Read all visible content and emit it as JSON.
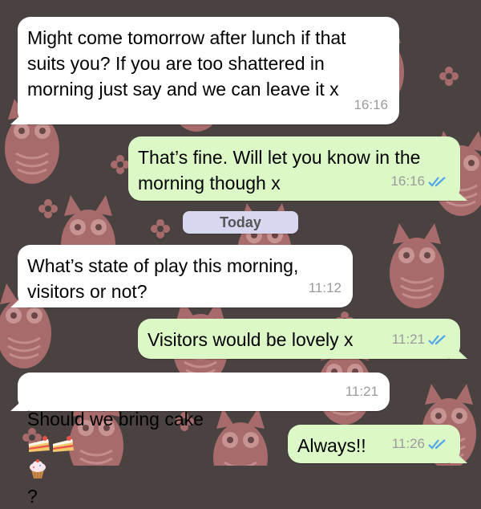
{
  "chat": {
    "date_separator": "Today",
    "messages": [
      {
        "text": "Might come tomorrow after lunch if that\nsuits you? If you are too shattered in\nmorning just say and we can leave it x",
        "time": "16:16"
      },
      {
        "text": "That’s fine. Will let you know in the\nmorning though x",
        "time": "16:16",
        "status_icon": "double-check-icon"
      },
      {
        "text": "What’s state of play this morning,\nvisitors or not?",
        "time": "11:12"
      },
      {
        "text": "Visitors would be lovely x",
        "time": "11:21",
        "status_icon": "double-check-icon"
      },
      {
        "text_before": "Should we bring cake",
        "emojis": [
          "cake-slice-icon",
          "cake-slice-icon",
          "cupcake-icon"
        ],
        "text_after": "?",
        "time": "11:21"
      },
      {
        "text": "Always!!",
        "time": "11:26",
        "status_icon": "double-check-icon"
      }
    ]
  },
  "colors": {
    "incoming_bubble": "#ffffff",
    "outgoing_bubble": "#dcf8c6",
    "read_ticks": "#4fa6e8",
    "wallpaper": "#4a4241",
    "owl_pattern": "#a86b6b",
    "date_pill": "#d7d7f0"
  }
}
